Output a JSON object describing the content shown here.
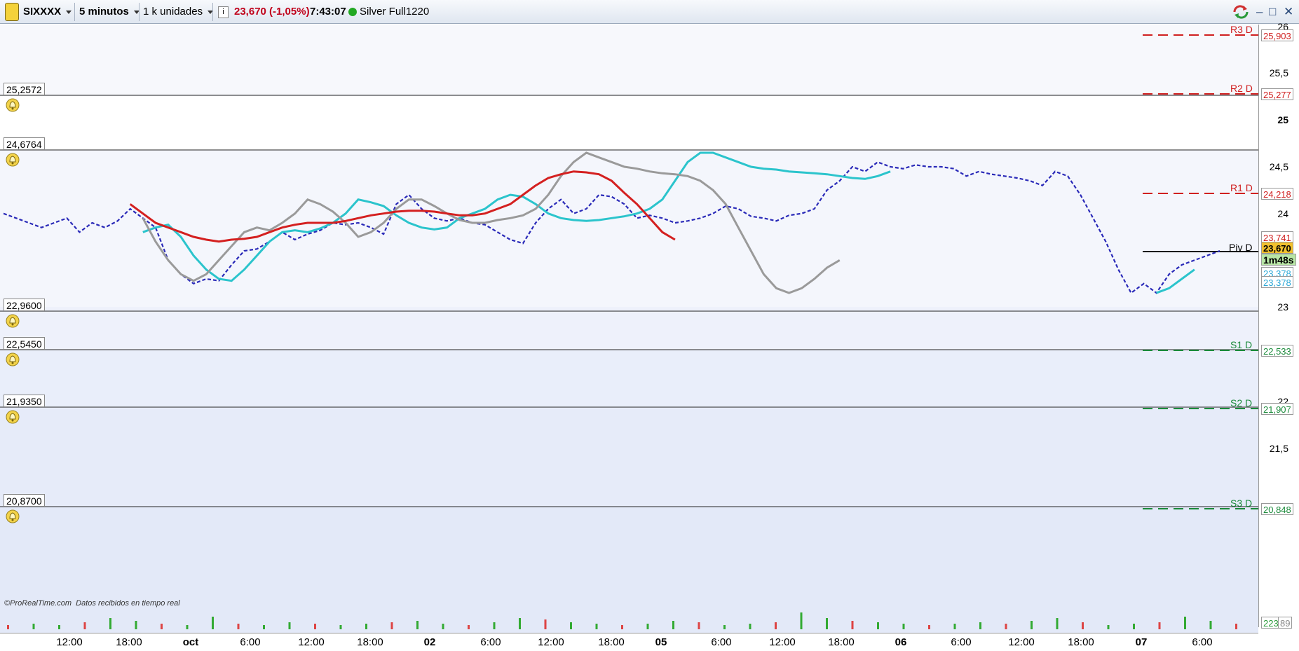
{
  "toolbar": {
    "instrument": "SIXXXX",
    "timeframe": "5 minutos",
    "units": "1 k unidades",
    "last_price": "23,670 (-1,05%)",
    "time": "7:43:07",
    "account": "Silver Full1220",
    "icons": [
      "bullion-logo-icon",
      "caret-down-icon",
      "info-icon",
      "status-dot-icon",
      "refresh-icon",
      "minimize-icon",
      "maximize-icon",
      "close-icon"
    ],
    "colors": {
      "price_down": "#c0001a",
      "status_dot": "#22a822"
    }
  },
  "alert_levels": [
    {
      "label": "25,2572"
    },
    {
      "label": "24,6764"
    },
    {
      "label": "22,9600"
    },
    {
      "label": "22,5450"
    },
    {
      "label": "21,9350"
    },
    {
      "label": "20,8700"
    }
  ],
  "pivots": [
    {
      "name": "R3 D",
      "value": "25,903",
      "color": "#d02020"
    },
    {
      "name": "R2 D",
      "value": "25,277",
      "color": "#d02020"
    },
    {
      "name": "R1 D",
      "value": "24,218",
      "color": "#d02020"
    },
    {
      "name": "Piv D",
      "value": "",
      "color": "#000000"
    },
    {
      "name": "S1 D",
      "value": "22,533",
      "color": "#1a8a3a"
    },
    {
      "name": "S2 D",
      "value": "21,907",
      "color": "#1a8a3a"
    },
    {
      "name": "S3 D",
      "value": "20,848",
      "color": "#1a8a3a"
    }
  ],
  "price_tags": [
    {
      "text": "23,741",
      "color": "#d02020",
      "bg": "#ffffff"
    },
    {
      "text": "23,670",
      "color": "#000000",
      "bg": "#f2c12e"
    },
    {
      "text": "1m48s",
      "color": "#000000",
      "bg": "#b8e6a6"
    },
    {
      "text": "23,378",
      "color": "#2aa7d6",
      "bg": "#ffffff"
    },
    {
      "text": "23,378",
      "color": "#2aa7d6",
      "bg": "#ffffff"
    }
  ],
  "volume_tags": [
    "223",
    "89"
  ],
  "credit": {
    "brand": "ProRealTime.com",
    "note": "Datos recibidos en tiempo real"
  },
  "chart_data": {
    "type": "line",
    "title": "",
    "xlabel": "",
    "ylabel": "",
    "ylim": [
      20.85,
      26.05
    ],
    "grid": false,
    "y_ticks": [
      "26",
      "25,5",
      "25",
      "24,5",
      "24",
      "23",
      "22",
      "21,5"
    ],
    "x_ticks": [
      "12:00",
      "18:00",
      "oct",
      "6:00",
      "12:00",
      "18:00",
      "02",
      "6:00",
      "12:00",
      "18:00",
      "05",
      "6:00",
      "12:00",
      "18:00",
      "06",
      "6:00",
      "12:00",
      "18:00",
      "07",
      "6:00"
    ],
    "x_bold": [
      "oct",
      "02",
      "05",
      "06",
      "07"
    ],
    "series": [
      {
        "color": "#2a2ab8",
        "style": "dashed",
        "values": [
          24.0,
          23.95,
          23.9,
          23.85,
          23.9,
          23.95,
          23.8,
          23.9,
          23.85,
          23.92,
          24.05,
          23.95,
          23.85,
          23.5,
          23.35,
          23.25,
          23.3,
          23.28,
          23.45,
          23.6,
          23.62,
          23.7,
          23.8,
          23.72,
          23.78,
          23.82,
          23.9,
          23.88,
          23.9,
          23.85,
          23.78,
          24.1,
          24.2,
          24.05,
          23.95,
          23.92,
          23.95,
          23.9,
          23.88,
          23.8,
          23.72,
          23.68,
          23.9,
          24.05,
          24.15,
          24.0,
          24.05,
          24.2,
          24.18,
          24.1,
          23.95,
          23.98,
          23.95,
          23.9,
          23.92,
          23.95,
          24.0,
          24.08,
          24.05,
          23.97,
          23.95,
          23.92,
          23.98,
          24.0,
          24.05,
          24.25,
          24.35,
          24.5,
          24.45,
          24.55,
          24.5,
          24.48,
          24.52,
          24.5,
          24.5,
          24.48,
          24.4,
          24.45,
          24.42,
          24.4,
          24.38,
          24.35,
          24.3,
          24.45,
          24.4,
          24.2,
          23.95,
          23.7,
          23.4,
          23.15,
          23.25,
          23.15,
          23.35,
          23.45,
          23.5,
          23.55,
          23.6
        ]
      },
      {
        "color": "#2bc4cc",
        "style": "solid",
        "values": [
          null,
          null,
          null,
          null,
          null,
          null,
          null,
          null,
          null,
          null,
          null,
          23.8,
          23.85,
          23.88,
          23.75,
          23.55,
          23.4,
          23.3,
          23.28,
          23.4,
          23.55,
          23.7,
          23.8,
          23.82,
          23.8,
          23.84,
          23.9,
          24.0,
          24.15,
          24.12,
          24.08,
          23.98,
          23.9,
          23.85,
          23.83,
          23.85,
          23.95,
          24.0,
          24.05,
          24.15,
          24.2,
          24.18,
          24.1,
          24.0,
          23.95,
          23.93,
          23.92,
          23.93,
          23.95,
          23.97,
          24.0,
          24.05,
          24.15,
          24.35,
          24.55,
          24.65,
          24.65,
          24.6,
          24.55,
          24.5,
          24.48,
          24.47,
          24.45,
          24.44,
          24.43,
          24.42,
          24.4,
          24.38,
          24.37,
          24.4,
          24.45,
          null,
          null,
          null,
          null,
          null,
          null,
          null,
          null,
          null,
          null,
          null,
          null,
          null,
          null,
          null,
          null,
          null,
          null,
          null,
          null,
          23.15,
          23.2,
          23.3,
          23.4
        ]
      },
      {
        "color": "#9a9a9a",
        "style": "solid",
        "values": [
          null,
          null,
          null,
          null,
          null,
          null,
          null,
          null,
          null,
          null,
          null,
          23.95,
          23.7,
          23.5,
          23.35,
          23.28,
          23.35,
          23.5,
          23.65,
          23.8,
          23.85,
          23.82,
          23.9,
          24.0,
          24.15,
          24.1,
          24.02,
          23.9,
          23.75,
          23.8,
          23.9,
          24.05,
          24.15,
          24.15,
          24.08,
          24.0,
          23.93,
          23.9,
          23.9,
          23.93,
          23.95,
          23.98,
          24.05,
          24.2,
          24.4,
          24.55,
          24.65,
          24.6,
          24.55,
          24.5,
          24.48,
          24.45,
          24.43,
          24.42,
          24.4,
          24.35,
          24.25,
          24.1,
          23.85,
          23.6,
          23.35,
          23.2,
          23.15,
          23.2,
          23.3,
          23.42,
          23.5,
          null,
          null,
          null,
          null,
          null,
          null,
          null,
          null,
          null,
          null,
          null,
          null,
          null,
          null,
          null,
          null,
          null,
          null,
          null,
          null,
          null,
          null,
          null,
          null,
          null,
          null,
          null,
          null,
          null,
          null
        ]
      },
      {
        "color": "#d42020",
        "style": "solid",
        "values": [
          null,
          null,
          null,
          null,
          null,
          null,
          null,
          null,
          null,
          null,
          24.1,
          24.0,
          23.9,
          23.85,
          23.8,
          23.75,
          23.72,
          23.7,
          23.72,
          23.73,
          23.75,
          23.8,
          23.85,
          23.88,
          23.9,
          23.9,
          23.9,
          23.92,
          23.95,
          23.98,
          24.0,
          24.02,
          24.03,
          24.03,
          24.02,
          24.0,
          23.98,
          23.98,
          24.0,
          24.05,
          24.1,
          24.2,
          24.3,
          24.38,
          24.42,
          24.45,
          24.44,
          24.42,
          24.35,
          24.22,
          24.1,
          23.95,
          23.8,
          23.72,
          null,
          null,
          null,
          null,
          null,
          null,
          null,
          null,
          null,
          null,
          null,
          null,
          null,
          null,
          null,
          null,
          null,
          null,
          null,
          null,
          null,
          null,
          null,
          null,
          null,
          null,
          null,
          null,
          null,
          null,
          null,
          null,
          null,
          null,
          null,
          null,
          null,
          null,
          null,
          null,
          null,
          null,
          null,
          null,
          null
        ]
      }
    ],
    "volume": [
      3,
      4,
      3,
      5,
      8,
      6,
      4,
      3,
      9,
      4,
      3,
      5,
      4,
      3,
      4,
      5,
      6,
      4,
      3,
      5,
      8,
      7,
      5,
      4,
      3,
      4,
      6,
      5,
      3,
      4,
      5,
      12,
      8,
      6,
      5,
      4,
      3,
      4,
      5,
      4,
      6,
      8,
      5,
      3,
      4,
      5,
      9,
      6,
      4
    ]
  }
}
